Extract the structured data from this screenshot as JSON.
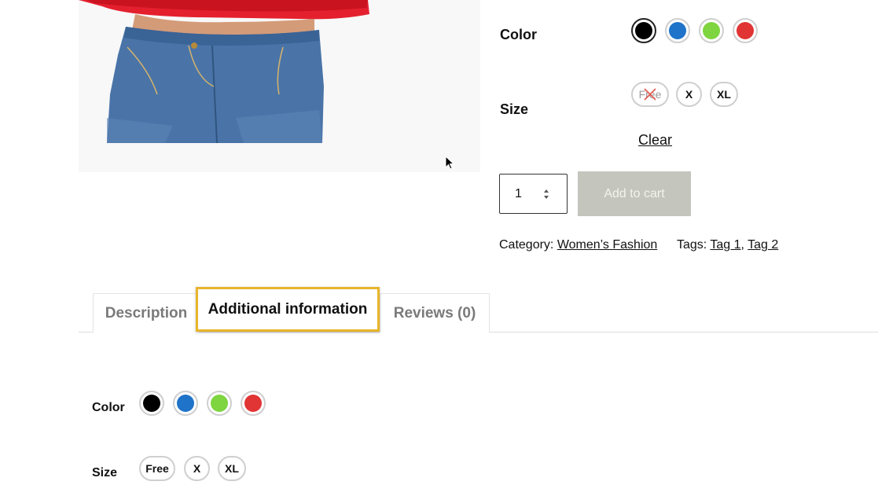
{
  "product": {
    "variations": {
      "color_label": "Color",
      "colors": [
        {
          "name": "black",
          "hex": "#000000",
          "selected": true
        },
        {
          "name": "blue",
          "hex": "#1f73c9",
          "selected": false
        },
        {
          "name": "green",
          "hex": "#7ed53f",
          "selected": false
        },
        {
          "name": "red",
          "hex": "#e13434",
          "selected": false
        }
      ],
      "size_label": "Size",
      "sizes": [
        {
          "label": "Free",
          "available": false
        },
        {
          "label": "X",
          "available": true
        },
        {
          "label": "XL",
          "available": true
        }
      ],
      "clear_label": "Clear"
    },
    "quantity": "1",
    "add_to_cart_label": "Add to cart",
    "meta": {
      "category_label": "Category:",
      "category_value": "Women’s Fashion",
      "tags_label": "Tags:",
      "tags": [
        "Tag 1",
        "Tag 2"
      ],
      "tag_separator": ","
    }
  },
  "tabs": [
    {
      "label": "Description",
      "active": false
    },
    {
      "label": "Additional information",
      "active": true
    },
    {
      "label": "Reviews (0)",
      "active": false
    }
  ],
  "additional_info": {
    "color_label": "Color",
    "colors": [
      {
        "name": "black",
        "hex": "#000000"
      },
      {
        "name": "blue",
        "hex": "#1f73c9"
      },
      {
        "name": "green",
        "hex": "#7ed53f"
      },
      {
        "name": "red",
        "hex": "#e13434"
      }
    ],
    "size_label": "Size",
    "sizes": [
      "Free",
      "X",
      "XL"
    ]
  },
  "colors": {
    "highlight_border": "#e8b52c",
    "add_to_cart_bg": "#c4c6bd"
  }
}
